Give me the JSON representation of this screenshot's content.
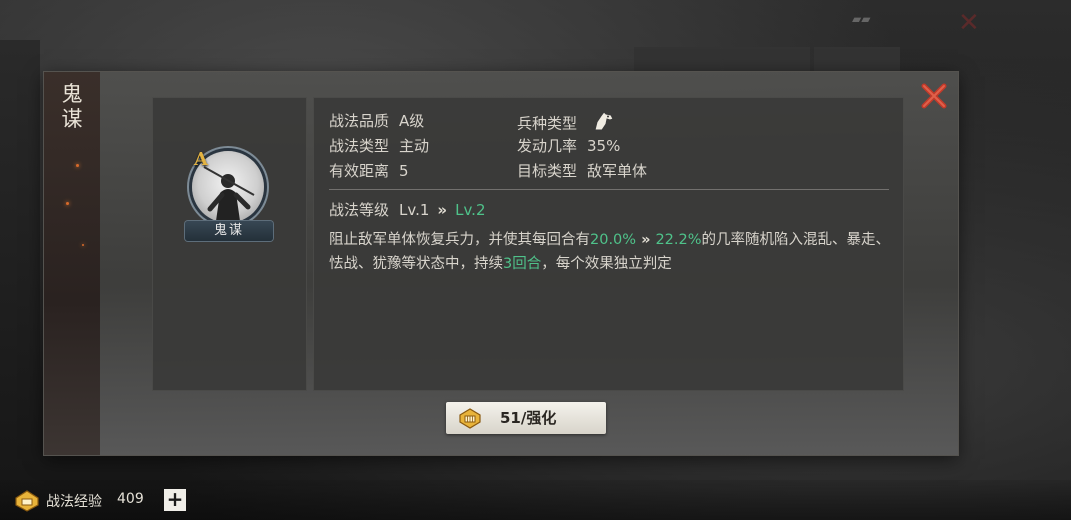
{
  "skill": {
    "name": "鬼谋",
    "grade": "A",
    "quality_label": "战法品质",
    "quality_value": "A级",
    "type_label": "战法类型",
    "type_value": "主动",
    "range_label": "有效距离",
    "range_value": "5",
    "troop_label": "兵种类型",
    "rate_label": "发动几率",
    "rate_value": "35%",
    "target_label": "目标类型",
    "target_value": "敌军单体",
    "level_label": "战法等级",
    "level_current": "Lv.1",
    "level_arrow": "»",
    "level_next": "Lv.2",
    "desc_part1": "阻止敌军单体恢复兵力，并使其每回合有",
    "desc_rate_current": "20.0%",
    "desc_arrow": "»",
    "desc_rate_next": "22.2%",
    "desc_part2": "的几率随机陷入混乱、暴走、怯战、犹豫等状态中，持续",
    "desc_duration": "3回合",
    "desc_part3": "，每个效果独立判定"
  },
  "upgrade_button": {
    "label": "51/强化"
  },
  "footer": {
    "exp_label": "战法经验",
    "exp_value": "409",
    "plus_label": "+"
  },
  "colors": {
    "highlight_green": "#4fc28a",
    "grade_gold": "#e3b341",
    "close_red": "#c23a2a"
  },
  "icons": [
    "close-icon",
    "cavalry-horse-icon",
    "coin-fist-icon",
    "skill-portrait-icon"
  ]
}
